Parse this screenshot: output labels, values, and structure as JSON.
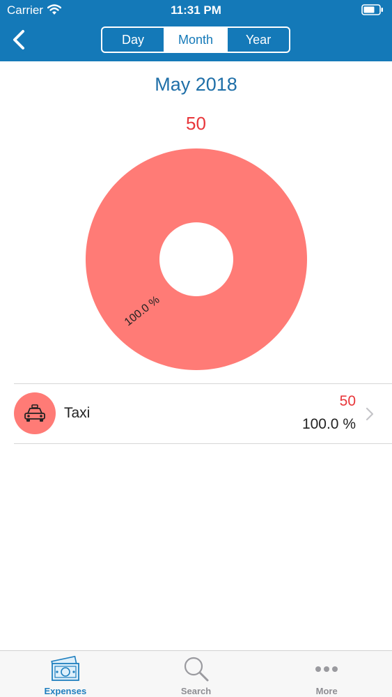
{
  "status_bar": {
    "carrier": "Carrier",
    "time": "11:31 PM"
  },
  "header": {
    "back_icon": "chevron-left-icon",
    "segments": [
      {
        "label": "Day",
        "selected": false
      },
      {
        "label": "Month",
        "selected": true
      },
      {
        "label": "Year",
        "selected": false
      }
    ]
  },
  "summary": {
    "period": "May 2018",
    "total": "50"
  },
  "chart_data": {
    "type": "pie",
    "categories": [
      "Taxi"
    ],
    "values": [
      50
    ],
    "slice_labels": [
      "100.0 %"
    ],
    "colors": [
      "#ff7b76"
    ],
    "donut": true
  },
  "categories": [
    {
      "name": "Taxi",
      "amount": "50",
      "percent": "100.0 %",
      "icon": "taxi-icon"
    }
  ],
  "tabbar": {
    "tabs": [
      {
        "label": "Expenses",
        "icon": "money-icon",
        "active": true
      },
      {
        "label": "Search",
        "icon": "search-icon",
        "active": false
      },
      {
        "label": "More",
        "icon": "more-dots-icon",
        "active": false
      }
    ]
  },
  "colors": {
    "header": "#1479b8",
    "accent": "#1f7fbf",
    "slice": "#ff7b76",
    "amount": "#e8363a"
  }
}
